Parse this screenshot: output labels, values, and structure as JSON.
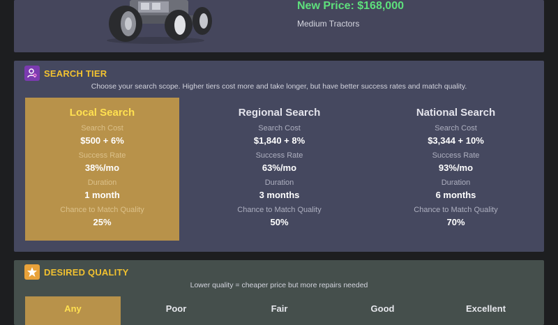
{
  "vehicle": {
    "new_price": "New Price: $168,000",
    "category": "Medium Tractors"
  },
  "search_tier": {
    "title": "SEARCH TIER",
    "description": "Choose your search scope. Higher tiers cost more and take longer, but have better success rates and match quality.",
    "labels": {
      "cost": "Search Cost",
      "success": "Success Rate",
      "duration": "Duration",
      "match": "Chance to Match Quality"
    },
    "tiers": [
      {
        "name": "Local Search",
        "cost": "$500 + 6%",
        "success": "38%/mo",
        "duration": "1 month",
        "match": "25%"
      },
      {
        "name": "Regional Search",
        "cost": "$1,840 + 8%",
        "success": "63%/mo",
        "duration": "3 months",
        "match": "50%"
      },
      {
        "name": "National Search",
        "cost": "$3,344 + 10%",
        "success": "93%/mo",
        "duration": "6 months",
        "match": "70%"
      }
    ],
    "selected": "Local Search"
  },
  "desired_quality": {
    "title": "DESIRED QUALITY",
    "description": "Lower quality = cheaper price but more repairs needed",
    "options": [
      "Any",
      "Poor",
      "Fair",
      "Good",
      "Excellent"
    ],
    "selected": "Any"
  },
  "colors": {
    "accent_yellow": "#f2c230",
    "price_green": "#5ee07c",
    "selected_card": "#b8924a",
    "tier_icon": "#7b3bb0",
    "quality_icon": "#e8a23a"
  },
  "icons": {
    "tier": "person-search-icon",
    "quality": "star-icon"
  }
}
